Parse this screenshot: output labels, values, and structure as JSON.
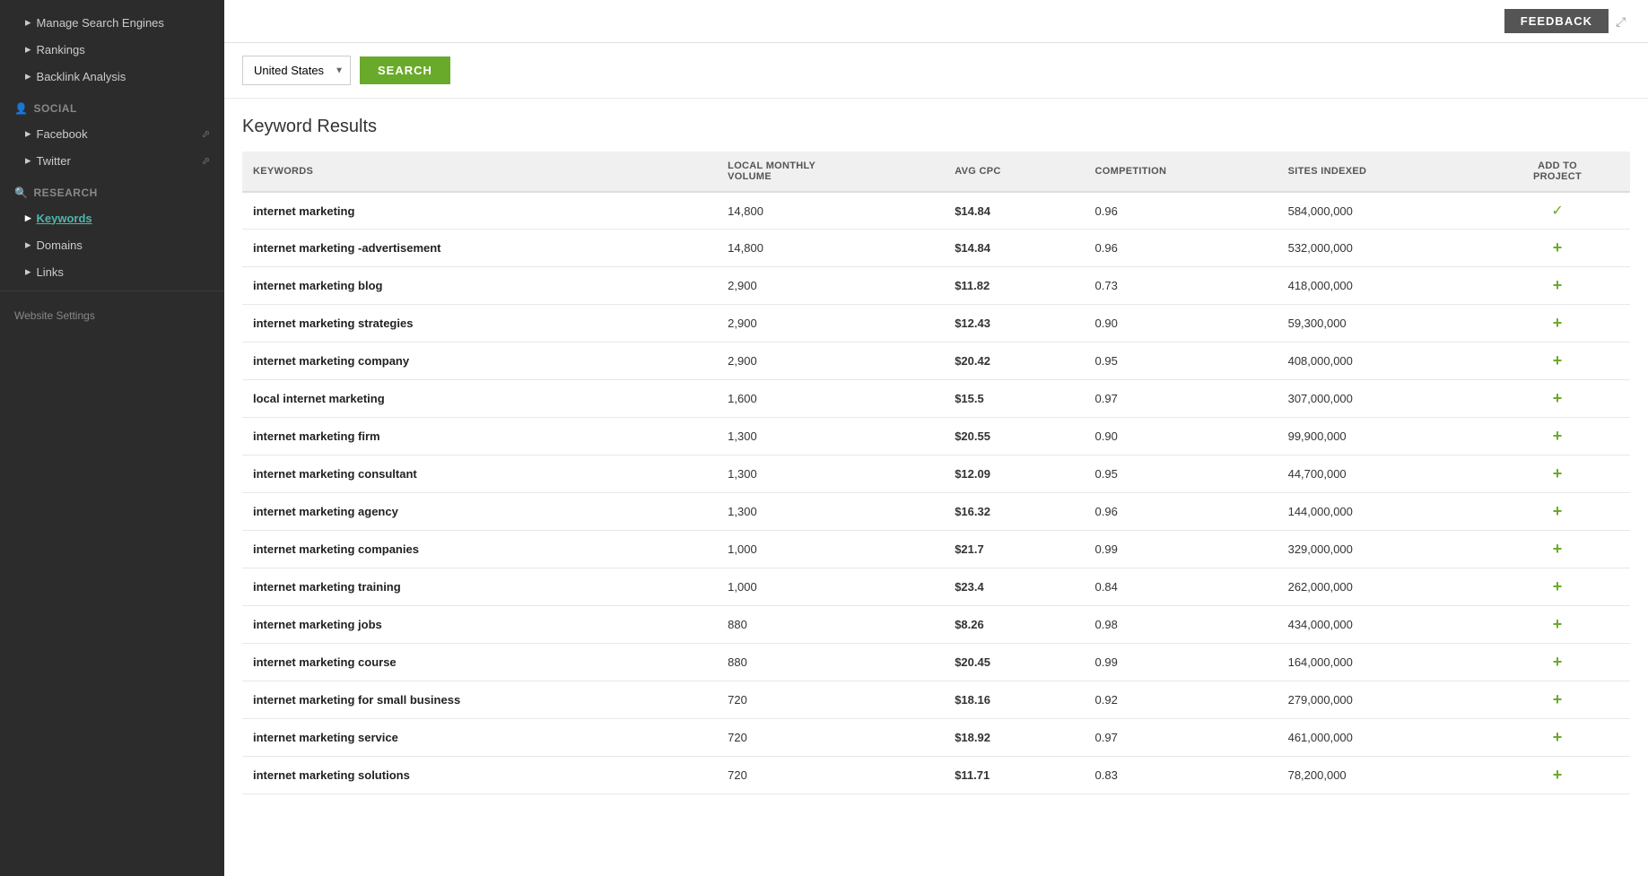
{
  "sidebar": {
    "sections": [
      {
        "id": "tools",
        "items": [
          {
            "label": "Manage Search Engines",
            "active": false,
            "type": "link"
          },
          {
            "label": "Rankings",
            "active": false,
            "type": "item"
          },
          {
            "label": "Backlink Analysis",
            "active": false,
            "type": "item"
          }
        ]
      },
      {
        "id": "social",
        "title": "Social",
        "icon": "👤",
        "items": [
          {
            "label": "Facebook",
            "active": false,
            "hasExt": true
          },
          {
            "label": "Twitter",
            "active": false,
            "hasExt": true
          }
        ]
      },
      {
        "id": "research",
        "title": "Research",
        "icon": "🔍",
        "items": [
          {
            "label": "Keywords",
            "active": true,
            "type": "link"
          },
          {
            "label": "Domains",
            "active": false
          },
          {
            "label": "Links",
            "active": false
          }
        ]
      }
    ],
    "websiteSettings": "Website Settings"
  },
  "topBar": {
    "feedbackLabel": "FEEDBACK"
  },
  "searchBar": {
    "country": "United States",
    "searchLabel": "SEARCH"
  },
  "results": {
    "title": "Keyword Results",
    "columns": [
      "KEYWORDS",
      "LOCAL MONTHLY VOLUME",
      "AVG CPC",
      "COMPETITION",
      "SITES INDEXED",
      "ADD TO PROJECT"
    ],
    "rows": [
      {
        "keyword": "internet marketing",
        "volume": "14,800",
        "cpc": "$14.84",
        "competition": "0.96",
        "sites": "584,000,000",
        "added": true
      },
      {
        "keyword": "internet marketing -advertisement",
        "volume": "14,800",
        "cpc": "$14.84",
        "competition": "0.96",
        "sites": "532,000,000",
        "added": false
      },
      {
        "keyword": "internet marketing blog",
        "volume": "2,900",
        "cpc": "$11.82",
        "competition": "0.73",
        "sites": "418,000,000",
        "added": false
      },
      {
        "keyword": "internet marketing strategies",
        "volume": "2,900",
        "cpc": "$12.43",
        "competition": "0.90",
        "sites": "59,300,000",
        "added": false
      },
      {
        "keyword": "internet marketing company",
        "volume": "2,900",
        "cpc": "$20.42",
        "competition": "0.95",
        "sites": "408,000,000",
        "added": false
      },
      {
        "keyword": "local internet marketing",
        "volume": "1,600",
        "cpc": "$15.5",
        "competition": "0.97",
        "sites": "307,000,000",
        "added": false
      },
      {
        "keyword": "internet marketing firm",
        "volume": "1,300",
        "cpc": "$20.55",
        "competition": "0.90",
        "sites": "99,900,000",
        "added": false
      },
      {
        "keyword": "internet marketing consultant",
        "volume": "1,300",
        "cpc": "$12.09",
        "competition": "0.95",
        "sites": "44,700,000",
        "added": false
      },
      {
        "keyword": "internet marketing agency",
        "volume": "1,300",
        "cpc": "$16.32",
        "competition": "0.96",
        "sites": "144,000,000",
        "added": false
      },
      {
        "keyword": "internet marketing companies",
        "volume": "1,000",
        "cpc": "$21.7",
        "competition": "0.99",
        "sites": "329,000,000",
        "added": false
      },
      {
        "keyword": "internet marketing training",
        "volume": "1,000",
        "cpc": "$23.4",
        "competition": "0.84",
        "sites": "262,000,000",
        "added": false
      },
      {
        "keyword": "internet marketing jobs",
        "volume": "880",
        "cpc": "$8.26",
        "competition": "0.98",
        "sites": "434,000,000",
        "added": false
      },
      {
        "keyword": "internet marketing course",
        "volume": "880",
        "cpc": "$20.45",
        "competition": "0.99",
        "sites": "164,000,000",
        "added": false
      },
      {
        "keyword": "internet marketing for small business",
        "volume": "720",
        "cpc": "$18.16",
        "competition": "0.92",
        "sites": "279,000,000",
        "added": false
      },
      {
        "keyword": "internet marketing service",
        "volume": "720",
        "cpc": "$18.92",
        "competition": "0.97",
        "sites": "461,000,000",
        "added": false
      },
      {
        "keyword": "internet marketing solutions",
        "volume": "720",
        "cpc": "$11.71",
        "competition": "0.83",
        "sites": "78,200,000",
        "added": false
      }
    ]
  }
}
